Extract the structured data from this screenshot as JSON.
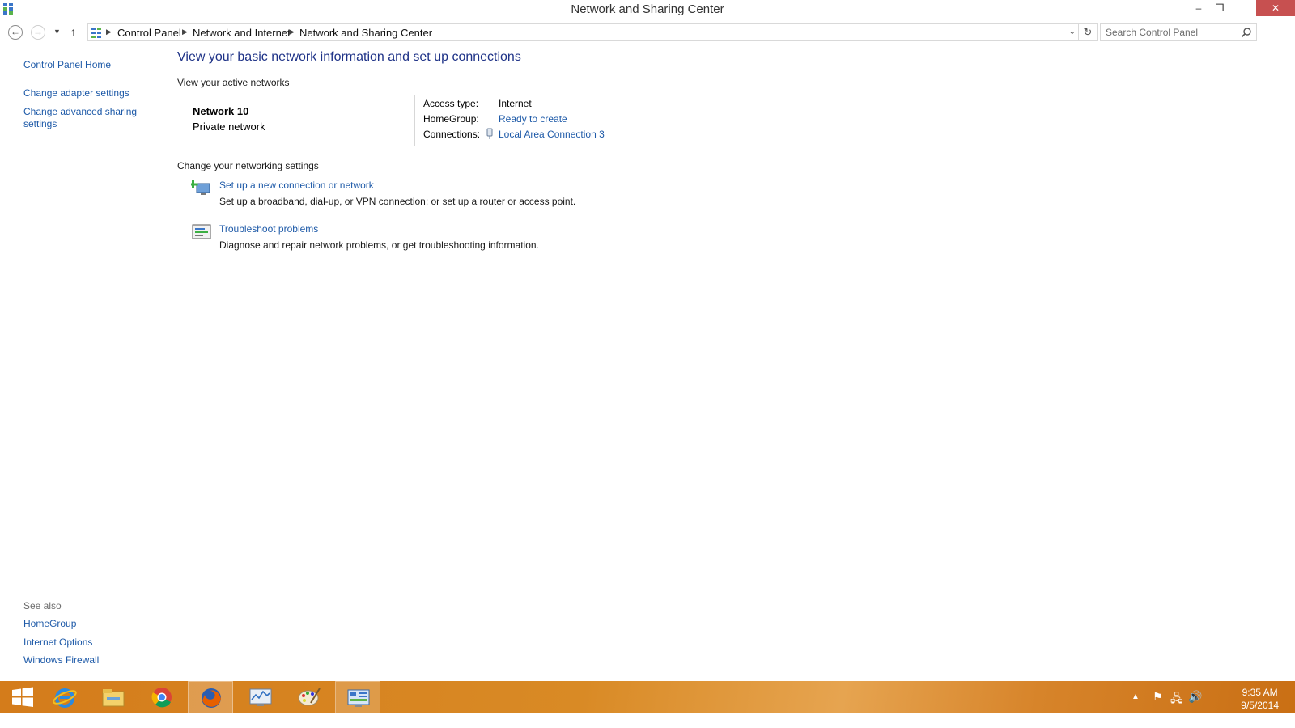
{
  "window": {
    "title": "Network and Sharing Center",
    "controls": {
      "minimize": "–",
      "restore": "❐",
      "close": "✕"
    }
  },
  "nav": {
    "back_icon": "back-arrow-icon",
    "forward_icon": "forward-arrow-icon",
    "recent_icon": "chevron-down-icon",
    "up_icon": "up-arrow-icon"
  },
  "address": {
    "breadcrumbs": [
      "Control Panel",
      "Network and Internet",
      "Network and Sharing Center"
    ],
    "search_placeholder": "Search Control Panel"
  },
  "sidebar": {
    "home": "Control Panel Home",
    "items": [
      "Change adapter settings",
      "Change advanced sharing settings"
    ],
    "see_also_title": "See also",
    "see_also": [
      "HomeGroup",
      "Internet Options",
      "Windows Firewall"
    ]
  },
  "main": {
    "title": "View your basic network information and set up connections",
    "active_networks_heading": "View your active networks",
    "network": {
      "name": "Network  10",
      "type": "Private network",
      "access_type_label": "Access type:",
      "access_type_value": "Internet",
      "homegroup_label": "HomeGroup:",
      "homegroup_value": "Ready to create",
      "connections_label": "Connections:",
      "connections_value": "Local Area Connection 3"
    },
    "change_settings_heading": "Change your networking settings",
    "tasks": [
      {
        "link": "Set up a new connection or network",
        "description": "Set up a broadband, dial-up, or VPN connection; or set up a router or access point."
      },
      {
        "link": "Troubleshoot problems",
        "description": "Diagnose and repair network problems, or get troubleshooting information."
      }
    ]
  },
  "taskbar": {
    "apps": [
      "start-icon",
      "internet-explorer-icon",
      "file-explorer-icon",
      "chrome-icon",
      "firefox-icon",
      "performance-monitor-icon",
      "paint-icon",
      "control-panel-icon"
    ],
    "clock": {
      "time": "9:35 AM",
      "date": "9/5/2014"
    }
  },
  "colors": {
    "link": "#1e5aa8",
    "title": "#1e3287",
    "taskbar": "#d98a25",
    "close": "#c75050"
  }
}
